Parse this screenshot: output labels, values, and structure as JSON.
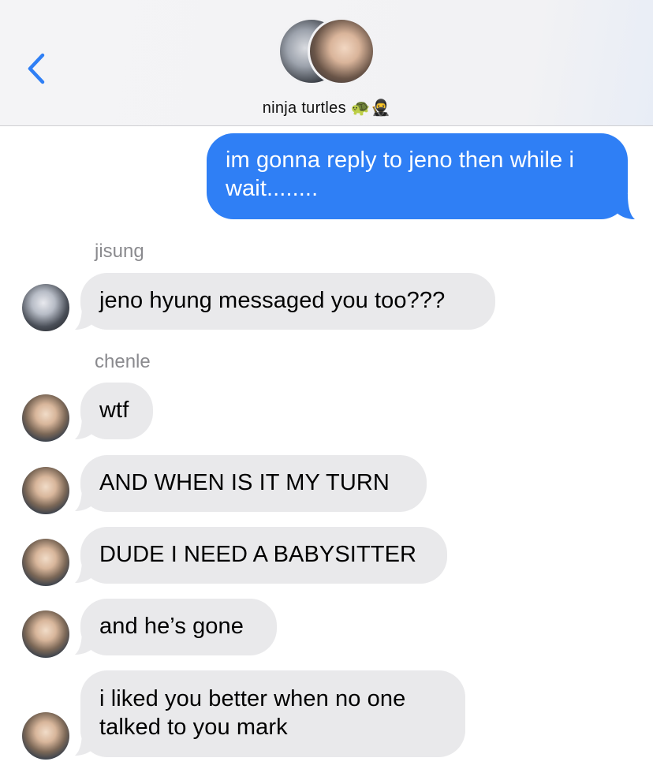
{
  "header": {
    "back_icon": "chevron-left-icon",
    "group_name": "ninja turtles",
    "group_emoji": "🐢🥷",
    "accent_color": "#2f7ff5"
  },
  "messages": [
    {
      "direction": "out",
      "text": "im gonna reply to jeno then while i wait........"
    },
    {
      "direction": "in",
      "sender": "jisung",
      "text": "jeno hyung messaged you too???"
    },
    {
      "direction": "in",
      "sender": "chenle",
      "text": "wtf"
    },
    {
      "direction": "in",
      "sender": "chenle",
      "text": "AND WHEN IS IT MY TURN"
    },
    {
      "direction": "in",
      "sender": "chenle",
      "text": "DUDE I NEED A BABYSITTER"
    },
    {
      "direction": "in",
      "sender": "chenle",
      "text": "and he’s gone"
    },
    {
      "direction": "in",
      "sender": "chenle",
      "text": "i liked you better when no one talked to you mark"
    }
  ],
  "colors": {
    "outgoing_bubble": "#2f7ff5",
    "incoming_bubble": "#e9e9eb",
    "sender_label": "#8a8a8e"
  }
}
